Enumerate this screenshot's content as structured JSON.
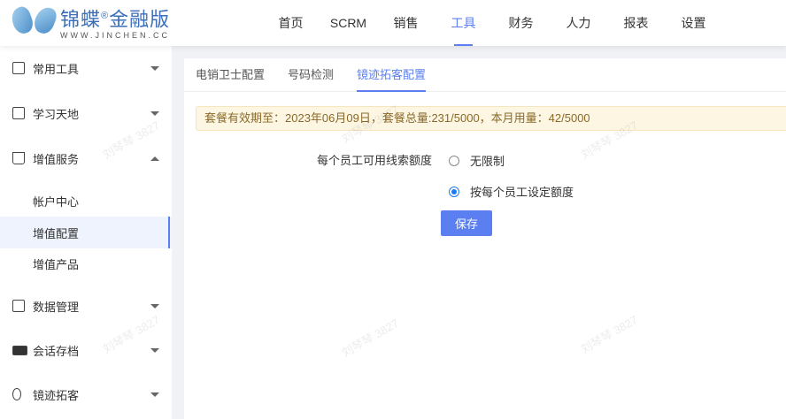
{
  "logo": {
    "cn": "锦蝶",
    "reg": "®",
    "sub": "金融版",
    "en": "WWW.JINCHEN.CC"
  },
  "nav": [
    {
      "label": "首页"
    },
    {
      "label": "SCRM"
    },
    {
      "label": "销售"
    },
    {
      "label": "工具",
      "active": true
    },
    {
      "label": "财务"
    },
    {
      "label": "人力"
    },
    {
      "label": "报表"
    },
    {
      "label": "设置"
    }
  ],
  "sidebar": {
    "items": [
      {
        "label": "常用工具",
        "icon": "clipboard-clock-icon"
      },
      {
        "label": "学习天地",
        "icon": "book-icon"
      },
      {
        "label": "增值服务",
        "icon": "crown-icon",
        "expanded": true
      },
      {
        "label": "数据管理",
        "icon": "board-icon"
      },
      {
        "label": "会话存档",
        "icon": "id-card-icon"
      },
      {
        "label": "镜迹拓客",
        "icon": "route-icon"
      }
    ],
    "sub_items": [
      {
        "label": "帐户中心"
      },
      {
        "label": "增值配置",
        "active": true
      },
      {
        "label": "增值产品"
      }
    ]
  },
  "tabs": [
    {
      "label": "电销卫士配置"
    },
    {
      "label": "号码检测"
    },
    {
      "label": "镜迹拓客配置",
      "active": true
    }
  ],
  "alert": "套餐有效期至：2023年06月09日，套餐总量:231/5000，本月用量：42/5000",
  "form": {
    "label": "每个员工可用线索额度",
    "options": [
      {
        "label": "无限制",
        "checked": false
      },
      {
        "label": "按每个员工设定额度",
        "checked": true
      }
    ],
    "save_label": "保存"
  },
  "watermark": "刘琴琴 3827",
  "colors": {
    "accent": "#5b7ff0",
    "radio": "#1a7cf0",
    "alert_bg": "#fdf6e3"
  }
}
